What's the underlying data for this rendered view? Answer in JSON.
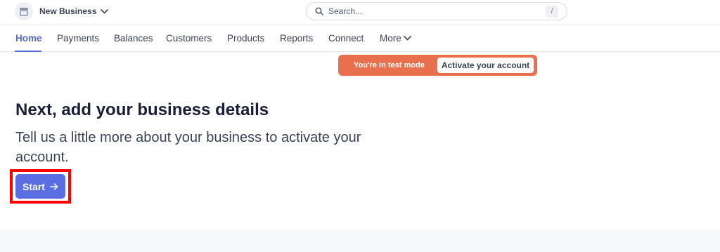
{
  "topbar": {
    "business_name": "New Business",
    "business_icon": "store-icon",
    "search_placeholder": "Search...",
    "search_shortcut": "/"
  },
  "nav": {
    "items": [
      {
        "label": "Home",
        "active": true
      },
      {
        "label": "Payments"
      },
      {
        "label": "Balances"
      },
      {
        "label": "Customers"
      },
      {
        "label": "Products"
      },
      {
        "label": "Reports"
      },
      {
        "label": "Connect"
      },
      {
        "label": "More"
      }
    ]
  },
  "banner": {
    "label": "You're in test mode",
    "button_label": "Activate your account"
  },
  "main": {
    "heading": "Next, add your business details",
    "description": "Tell us a little more about your business to activate your account.",
    "start_label": "Start"
  },
  "colors": {
    "accent": "#5469d4",
    "start_button": "#5b6ee1",
    "test_mode": "#e8704f",
    "highlight": "#ff0000"
  }
}
